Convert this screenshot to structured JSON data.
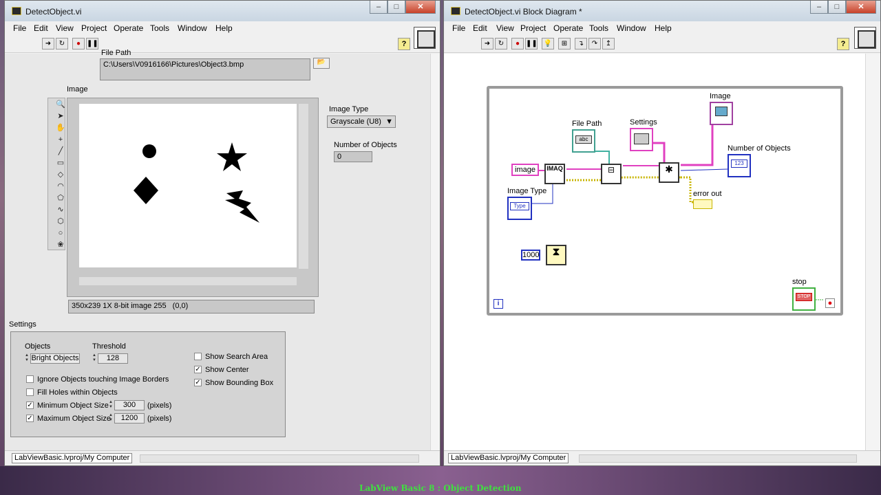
{
  "front_panel": {
    "title": "DetectObject.vi",
    "menu": [
      "File",
      "Edit",
      "View",
      "Project",
      "Operate",
      "Tools",
      "Window",
      "Help"
    ],
    "file_path_label": "File Path",
    "file_path_value": "C:\\Users\\V0916166\\Pictures\\Object3.bmp",
    "image_label": "Image",
    "image_info": "350x239 1X 8-bit image 255",
    "image_coords": "(0,0)",
    "image_type_label": "Image Type",
    "image_type_value": "Grayscale (U8)",
    "num_objects_label": "Number of Objects",
    "num_objects_value": "0",
    "settings_label": "Settings",
    "objects_label": "Objects",
    "objects_value": "Bright Objects",
    "threshold_label": "Threshold",
    "threshold_value": "128",
    "ignore_borders": {
      "label": "Ignore Objects touching Image Borders",
      "checked": false
    },
    "fill_holes": {
      "label": "Fill Holes within Objects",
      "checked": false
    },
    "min_size": {
      "label": "Minimum Object Size",
      "checked": true,
      "value": "300",
      "unit": "(pixels)"
    },
    "max_size": {
      "label": "Maximum Object Size",
      "checked": true,
      "value": "1200",
      "unit": "(pixels)"
    },
    "show_search_area": {
      "label": "Show Search Area",
      "checked": false
    },
    "show_center": {
      "label": "Show Center",
      "checked": true
    },
    "show_bounding_box": {
      "label": "Show Bounding Box",
      "checked": true
    },
    "project": "LabViewBasic.lvproj/My Computer"
  },
  "block_diagram": {
    "title": "DetectObject.vi Block Diagram *",
    "menu": [
      "File",
      "Edit",
      "View",
      "Project",
      "Operate",
      "Tools",
      "Window",
      "Help"
    ],
    "labels": {
      "image_top": "Image",
      "file_path": "File Path",
      "settings": "Settings",
      "num_objects": "Number of Objects",
      "image_const": "image",
      "imaq": "IMAQ",
      "image_type": "Image Type",
      "error_out": "error out",
      "wait_const": "1000",
      "stop": "stop",
      "num_indicator": "123",
      "type_ctrl": "Type",
      "stop_btn": "STOP"
    },
    "project": "LabViewBasic.lvproj/My Computer"
  },
  "caption": "LabView Basic 8 : Object Detection",
  "colors": {
    "wire_pink": "#e040c0",
    "wire_yellow": "#c8b400",
    "wire_green": "#40b040",
    "wire_blue": "#2030c0"
  }
}
